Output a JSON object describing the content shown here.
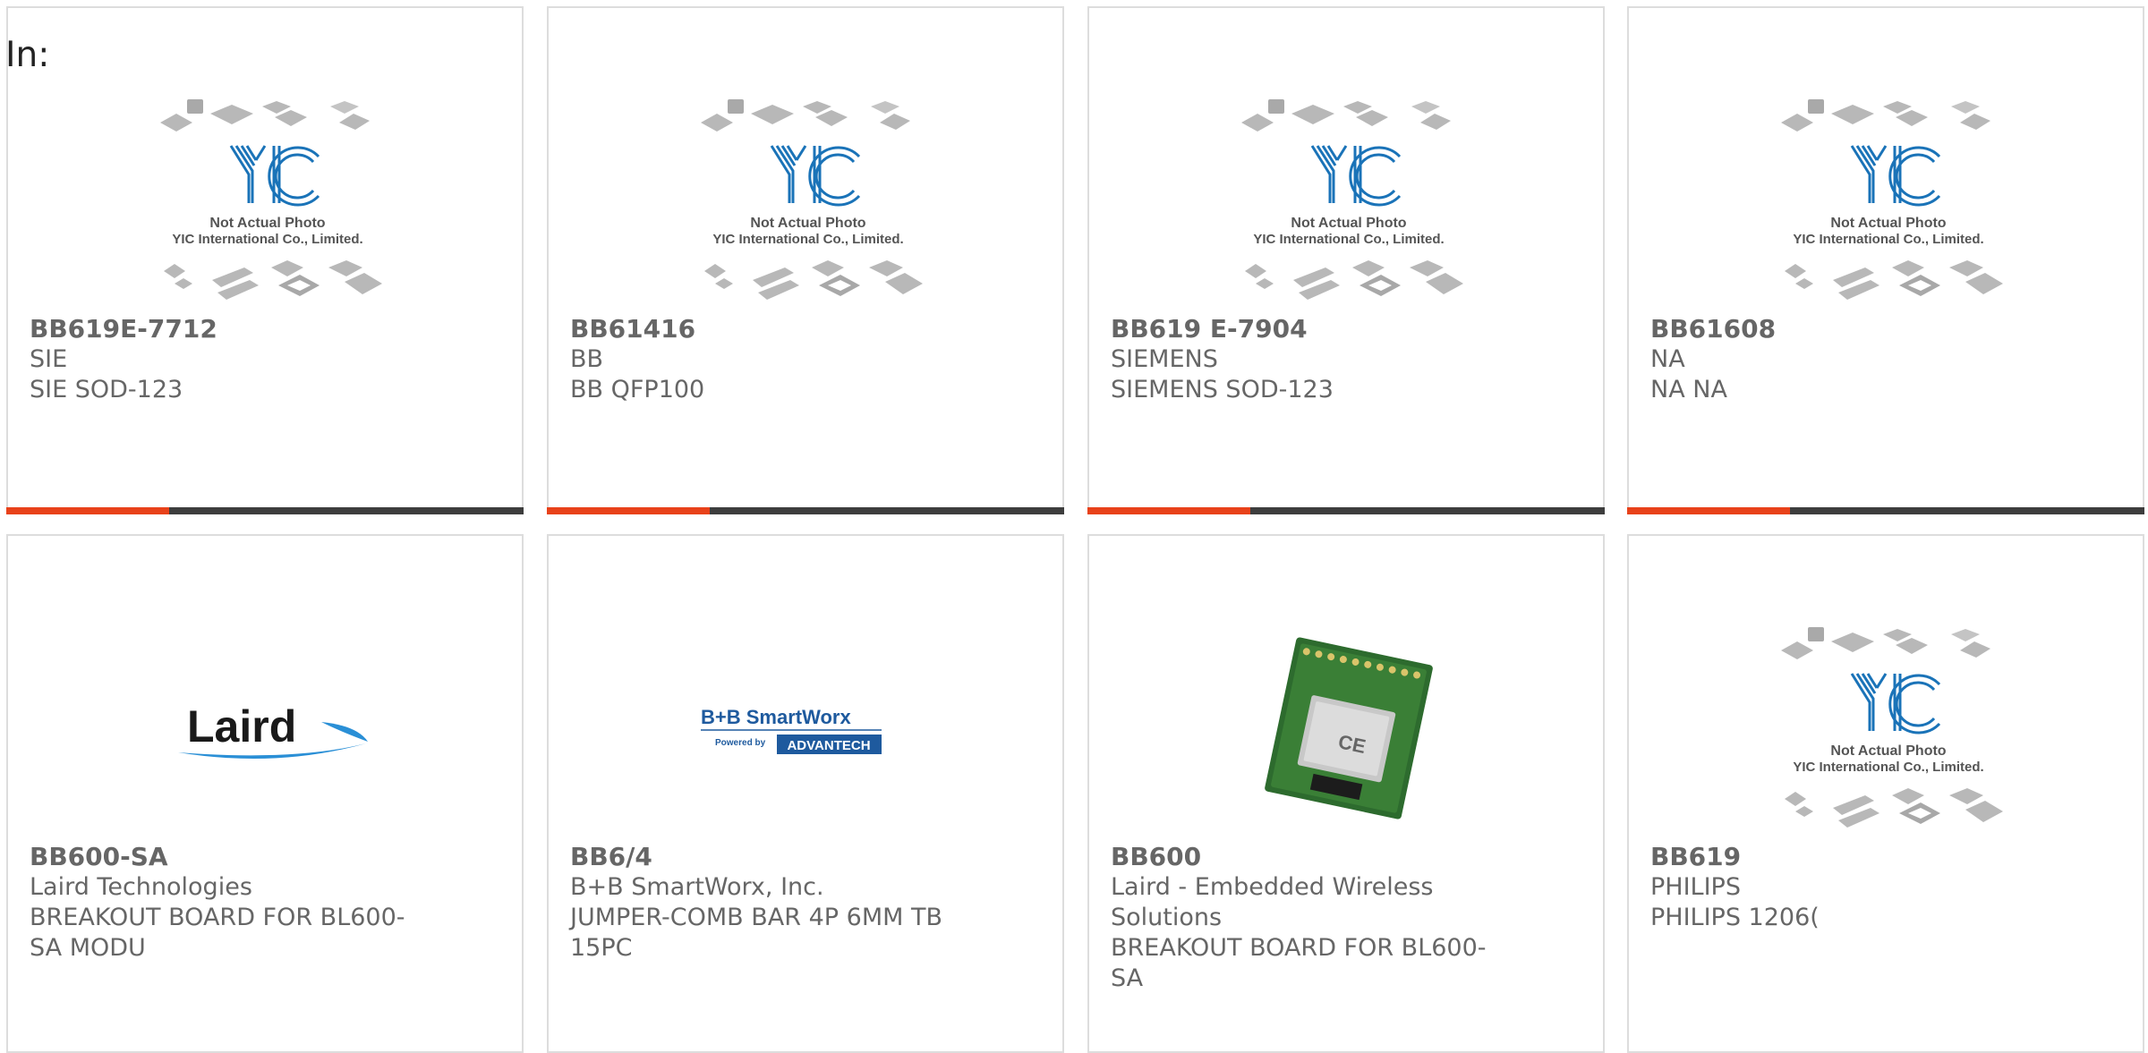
{
  "heading": "In:",
  "placeholder_logo": {
    "brand": "YIC",
    "line1": "Not Actual Photo",
    "line2": "YIC International Co., Limited."
  },
  "laird_logo": "Laird",
  "bb_logo": {
    "top": "B+B SmartWorx",
    "powered": "Powered by",
    "brand": "ADVANTECH"
  },
  "colors": {
    "accent": "#e8421a",
    "bar": "#3d3d3d",
    "border": "#dddddd",
    "text": "#666666",
    "yic_blue": "#1a73b8"
  },
  "products": [
    {
      "part": "BB619E-7712",
      "maker": "SIE",
      "desc": "SIE SOD-123",
      "image": "placeholder"
    },
    {
      "part": "BB61416",
      "maker": "BB",
      "desc": "BB QFP100",
      "image": "placeholder"
    },
    {
      "part": "BB619 E-7904",
      "maker": "SIEMENS",
      "desc": "SIEMENS SOD-123",
      "image": "placeholder"
    },
    {
      "part": "BB61608",
      "maker": "NA",
      "desc": "NA NA",
      "image": "placeholder"
    },
    {
      "part": "BB600-SA",
      "maker": "Laird Technologies",
      "desc": "BREAKOUT BOARD FOR BL600-SA MODU",
      "image": "laird-logo"
    },
    {
      "part": "BB6/4",
      "maker": "B+B SmartWorx, Inc.",
      "desc": "JUMPER-COMB BAR 4P 6MM TB 15PC",
      "image": "bb-smartworx-logo"
    },
    {
      "part": "BB600",
      "maker": "Laird - Embedded Wireless Solutions",
      "desc": "BREAKOUT BOARD FOR BL600-SA",
      "image": "module-photo"
    },
    {
      "part": "BB619",
      "maker": "PHILIPS",
      "desc": "PHILIPS 1206(",
      "image": "placeholder"
    }
  ]
}
